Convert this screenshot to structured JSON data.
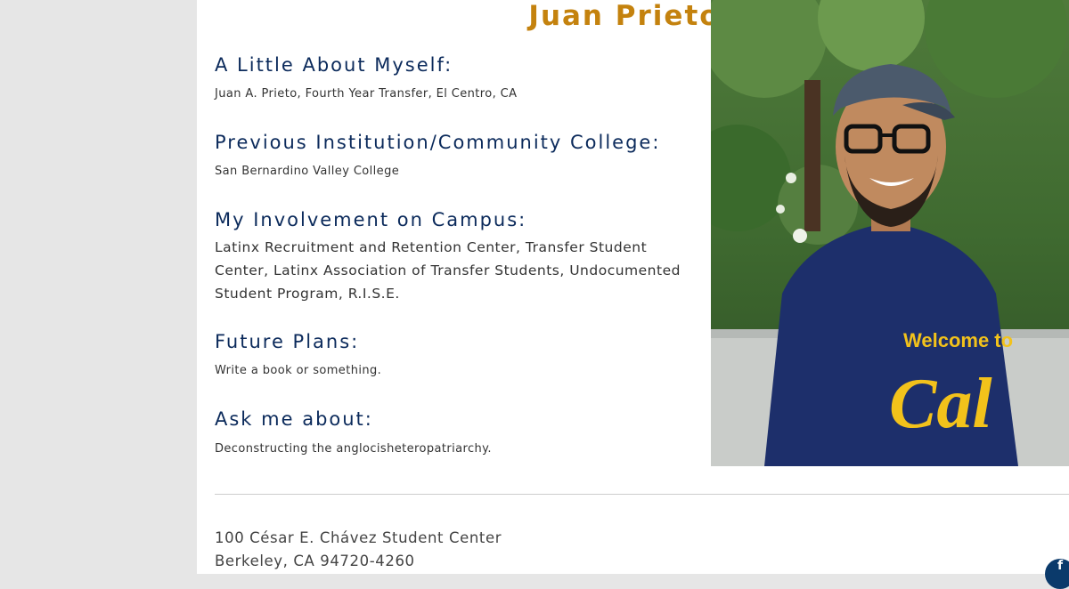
{
  "profile": {
    "name": "Juan Prieto"
  },
  "sections": [
    {
      "heading": "A Little About Myself:",
      "text": "Juan A. Prieto, Fourth Year Transfer, El Centro, CA"
    },
    {
      "heading": "Previous Institution/Community College:",
      "text": "San Bernardino Valley College"
    },
    {
      "heading": "My Involvement on Campus:",
      "text": "Latinx Recruitment and Retention Center, Transfer Student Center, Latinx Association of Transfer Students, Undocumented Student Program, R.I.S.E."
    },
    {
      "heading": "Future Plans:",
      "text": "Write a book or something."
    },
    {
      "heading": "Ask me about:",
      "text": "Deconstructing the anglocisheteropatriarchy."
    }
  ],
  "photo": {
    "shirt_text_top": "Welcome to",
    "shirt_text_bottom": "Cal"
  },
  "footer": {
    "address_line1": "100 César E. Chávez Student Center",
    "address_line2": "Berkeley, CA 94720-4260"
  },
  "social": {
    "facebook_glyph": "f"
  },
  "colors": {
    "name_gold": "#c4820e",
    "heading_navy": "#0b2a5b",
    "facebook_navy": "#0b3a6b"
  }
}
